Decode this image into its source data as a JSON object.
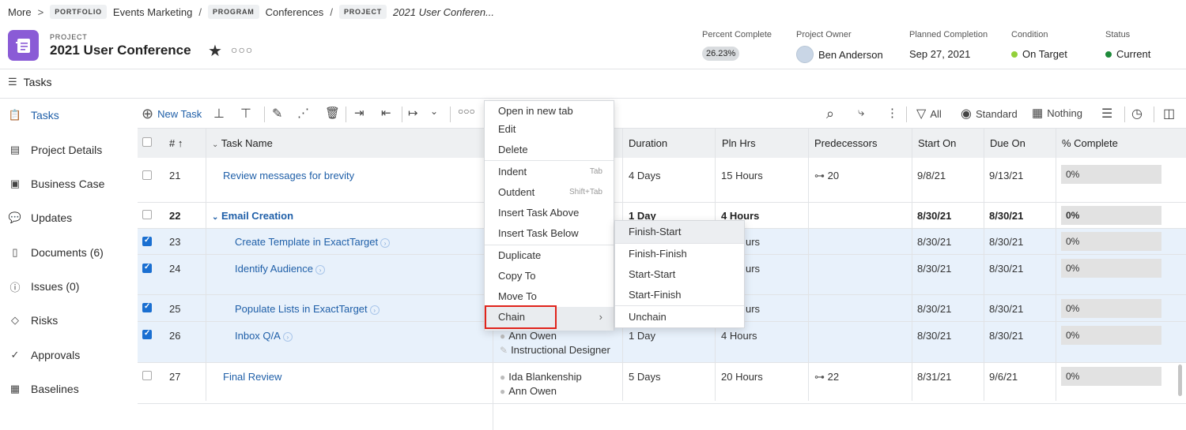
{
  "breadcrumb": {
    "more": "More",
    "chevron": ">",
    "portfolio_tag": "PORTFOLIO",
    "portfolio": "Events Marketing",
    "slash1": "/",
    "program_tag": "PROGRAM",
    "program": "Conferences",
    "slash2": "/",
    "project_tag": "PROJECT",
    "project": "2021 User Conferen..."
  },
  "header": {
    "label": "PROJECT",
    "title": "2021 User Conference",
    "star_icon": "star",
    "more_icon": "ellipsis",
    "percent_complete_label": "Percent Complete",
    "percent_complete": "26.23%",
    "owner_label": "Project Owner",
    "owner": "Ben Anderson",
    "planned_label": "Planned Completion",
    "planned": "Sep 27, 2021",
    "condition_label": "Condition",
    "condition": "On Target",
    "condition_color": "#93d03a",
    "status_label": "Status",
    "status": "Current",
    "status_color": "#1e8a3a"
  },
  "tasks_bar": {
    "label": "Tasks"
  },
  "sidebar": {
    "items": [
      {
        "label": "Tasks",
        "icon": "clipboard-check"
      },
      {
        "label": "Project Details",
        "icon": "document"
      },
      {
        "label": "Business Case",
        "icon": "briefcase-doc"
      },
      {
        "label": "Updates",
        "icon": "speech-bubble"
      },
      {
        "label": "Documents (6)",
        "icon": "file"
      },
      {
        "label": "Issues (0)",
        "icon": "alert-bubble"
      },
      {
        "label": "Risks",
        "icon": "diamond-alert"
      },
      {
        "label": "Approvals",
        "icon": "check-circle"
      },
      {
        "label": "Baselines",
        "icon": "baseline"
      }
    ]
  },
  "toolbar": {
    "new_task": "New Task",
    "filter_all": "All",
    "view_standard": "Standard",
    "group_nothing": "Nothing"
  },
  "columns": {
    "num": "#",
    "sort_arrow": "↑",
    "task_name": "Task Name",
    "duration": "Duration",
    "pln_hrs": "Pln Hrs",
    "predecessors": "Predecessors",
    "start_on": "Start On",
    "due_on": "Due On",
    "pct_complete": "% Complete"
  },
  "rows": [
    {
      "num": "21",
      "name": "Review messages for brevity",
      "duration": "4 Days",
      "pln": "15 Hours",
      "pred": "20",
      "start": "9/8/21",
      "due": "9/13/21",
      "pct": "0%"
    },
    {
      "num": "22",
      "name": "Email Creation",
      "duration": "1 Day",
      "pln": "4 Hours",
      "pred": "",
      "start": "8/30/21",
      "due": "8/30/21",
      "pct": "0%"
    },
    {
      "num": "23",
      "name": "Create Template in ExactTarget",
      "duration": "",
      "pln": "urs",
      "pred": "",
      "start": "8/30/21",
      "due": "8/30/21",
      "pct": "0%"
    },
    {
      "num": "24",
      "name": "Identify Audience",
      "duration": "",
      "pln": "urs",
      "pred": "",
      "start": "8/30/21",
      "due": "8/30/21",
      "pct": "0%"
    },
    {
      "num": "25",
      "name": "Populate Lists in ExactTarget",
      "duration": "",
      "pln": "urs",
      "pred": "",
      "start": "8/30/21",
      "due": "8/30/21",
      "pct": "0%"
    },
    {
      "num": "26",
      "name": "Inbox Q/A",
      "assignee1": "Ann Owen",
      "assignee2": "Instructional Designer",
      "duration": "1 Day",
      "pln": "4 Hours",
      "pred": "",
      "start": "8/30/21",
      "due": "8/30/21",
      "pct": "0%"
    },
    {
      "num": "27",
      "name": "Final Review",
      "assignee1": "Ida Blankenship",
      "assignee2": "Ann Owen",
      "duration": "5 Days",
      "pln": "20 Hours",
      "pred": "22",
      "start": "8/31/21",
      "due": "9/6/21",
      "pct": "0%"
    }
  ],
  "context_menu": {
    "open_new_tab": "Open in new tab",
    "edit": "Edit",
    "delete": "Delete",
    "indent": "Indent",
    "indent_shortcut": "Tab",
    "outdent": "Outdent",
    "outdent_shortcut": "Shift+Tab",
    "insert_above": "Insert Task Above",
    "insert_below": "Insert Task Below",
    "duplicate": "Duplicate",
    "copy_to": "Copy To",
    "move_to": "Move To",
    "chain": "Chain",
    "chain_arrow": "›"
  },
  "chain_submenu": {
    "finish_start": "Finish-Start",
    "finish_finish": "Finish-Finish",
    "start_start": "Start-Start",
    "start_finish": "Start-Finish",
    "unchain": "Unchain"
  }
}
